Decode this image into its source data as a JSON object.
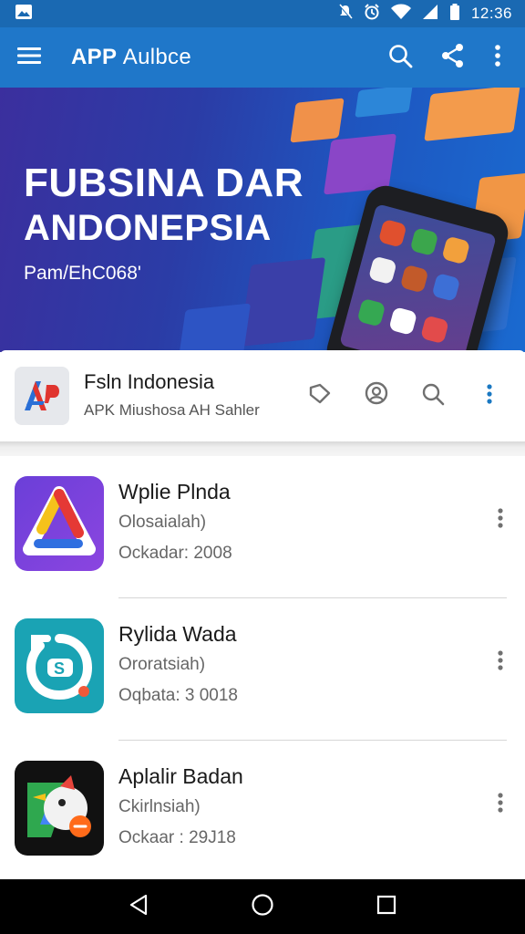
{
  "status_bar": {
    "time": "12:36",
    "icons": [
      "gallery-notification-icon",
      "mute-icon",
      "alarm-icon",
      "wifi-icon",
      "signal-icon",
      "battery-icon"
    ]
  },
  "app_bar": {
    "title_bold": "APP",
    "title_rest": "Aulbce",
    "actions": [
      "search-icon",
      "share-icon",
      "more-vert-icon"
    ]
  },
  "banner": {
    "line1": "FUBSINA DAR",
    "line2": "ANDONEPSIA",
    "subtitle": "Pam/EhC068'"
  },
  "featured": {
    "logo_text": "AP",
    "title": "Fsln Indonesia",
    "subtitle": "APK Miushosa AH Sahler",
    "actions": [
      "tag-icon",
      "face-icon",
      "search-icon",
      "more-vert-icon"
    ]
  },
  "apps": [
    {
      "name": "Wplie Plnda",
      "category": "Olosaialah)",
      "date": "Ockadar: 2008",
      "icon": "triangle-app-icon"
    },
    {
      "name": "Rylida Wada",
      "category": "Ororatsiah)",
      "date": "Oqbata: 3 0018",
      "icon": "sync-app-icon"
    },
    {
      "name": "Aplalir Badan",
      "category": "Ckirlnsiah)",
      "date": "Ockaar : 29J18",
      "icon": "bird-app-icon"
    }
  ],
  "nav_bar": [
    "back-icon",
    "home-icon",
    "recents-icon"
  ],
  "colors": {
    "status_bar": "#1a69b2",
    "app_bar": "#1f77c9",
    "accent": "#1a78c2"
  }
}
